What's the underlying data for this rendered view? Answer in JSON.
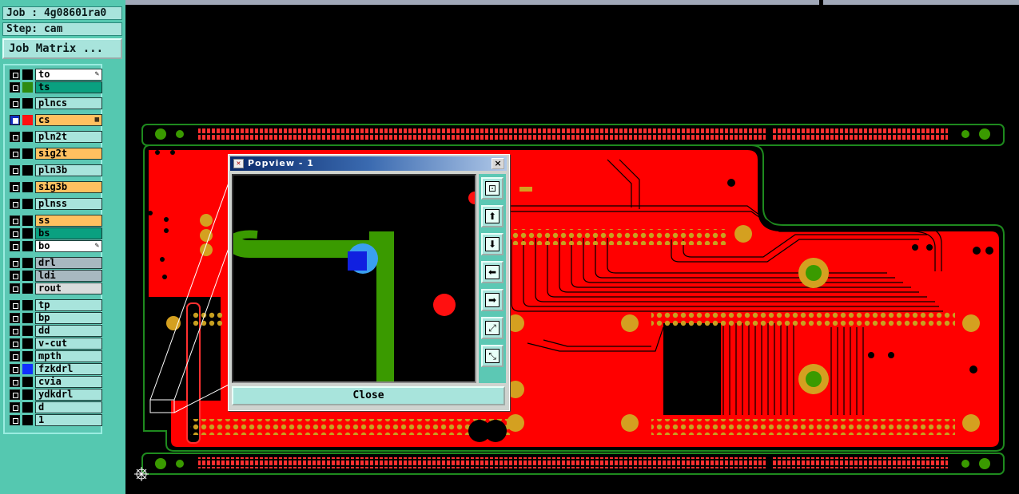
{
  "header": {
    "job_label": "Job : 4g08601ra0",
    "step_label": "Step: cam",
    "job_matrix_button": "Job Matrix ..."
  },
  "layers": [
    {
      "name": "to",
      "checked": false,
      "swatch": "#000000",
      "bg": "#ffffff",
      "marker": "edit"
    },
    {
      "name": "ts",
      "checked": false,
      "swatch": "#2e8b10",
      "bg": "#0aa080",
      "marker": ""
    },
    {
      "name": "plncs",
      "checked": false,
      "swatch": "#000000",
      "bg": "#a8e4dc",
      "marker": ""
    },
    {
      "name": "cs",
      "checked": true,
      "swatch": "#ff1010",
      "bg": "#ffc060",
      "marker": "grid"
    },
    {
      "name": "pln2t",
      "checked": false,
      "swatch": "#000000",
      "bg": "#a8e4dc",
      "marker": ""
    },
    {
      "name": "sig2t",
      "checked": false,
      "swatch": "#000000",
      "bg": "#ffc060",
      "marker": ""
    },
    {
      "name": "pln3b",
      "checked": false,
      "swatch": "#000000",
      "bg": "#a8e4dc",
      "marker": ""
    },
    {
      "name": "sig3b",
      "checked": false,
      "swatch": "#000000",
      "bg": "#ffc060",
      "marker": ""
    },
    {
      "name": "plnss",
      "checked": false,
      "swatch": "#000000",
      "bg": "#a8e4dc",
      "marker": ""
    },
    {
      "name": "ss",
      "checked": false,
      "swatch": "#000000",
      "bg": "#ffc060",
      "marker": ""
    },
    {
      "name": "bs",
      "checked": false,
      "swatch": "#000000",
      "bg": "#0aa080",
      "marker": ""
    },
    {
      "name": "bo",
      "checked": false,
      "swatch": "#000000",
      "bg": "#ffffff",
      "marker": "edit"
    },
    {
      "name": "drl",
      "checked": false,
      "swatch": "#000000",
      "bg": "#a8b8c0",
      "marker": ""
    },
    {
      "name": "ldi",
      "checked": false,
      "swatch": "#000000",
      "bg": "#a8b8c0",
      "marker": ""
    },
    {
      "name": "rout",
      "checked": false,
      "swatch": "#000000",
      "bg": "#d8dcdc",
      "marker": ""
    },
    {
      "name": "tp",
      "checked": false,
      "swatch": "#000000",
      "bg": "#a8e4dc",
      "marker": ""
    },
    {
      "name": "bp",
      "checked": false,
      "swatch": "#000000",
      "bg": "#a8e4dc",
      "marker": ""
    },
    {
      "name": "dd",
      "checked": false,
      "swatch": "#000000",
      "bg": "#a8e4dc",
      "marker": ""
    },
    {
      "name": "v-cut",
      "checked": false,
      "swatch": "#000000",
      "bg": "#a8e4dc",
      "marker": ""
    },
    {
      "name": "mpth",
      "checked": false,
      "swatch": "#000000",
      "bg": "#a8e4dc",
      "marker": ""
    },
    {
      "name": "fzkdrl",
      "checked": false,
      "swatch": "#1030ff",
      "bg": "#a8e4dc",
      "marker": ""
    },
    {
      "name": "cvia",
      "checked": false,
      "swatch": "#000000",
      "bg": "#a8e4dc",
      "marker": ""
    },
    {
      "name": "ydkdrl",
      "checked": false,
      "swatch": "#000000",
      "bg": "#a8e4dc",
      "marker": ""
    },
    {
      "name": "d",
      "checked": false,
      "swatch": "#000000",
      "bg": "#a8e4dc",
      "marker": ""
    },
    {
      "name": "1",
      "checked": false,
      "swatch": "#000000",
      "bg": "#a8e4dc",
      "marker": ""
    }
  ],
  "popview": {
    "title": "Popview - 1",
    "close_x": "×",
    "close_button": "Close",
    "tools": [
      {
        "name": "zoom-window-icon"
      },
      {
        "name": "pan-up-icon"
      },
      {
        "name": "pan-down-icon"
      },
      {
        "name": "pan-left-icon"
      },
      {
        "name": "pan-right-icon"
      },
      {
        "name": "zoom-in-icon"
      },
      {
        "name": "zoom-out-icon"
      }
    ]
  },
  "colors": {
    "board_copper": "#ff0000",
    "board_outline": "#1e8a1e",
    "pad": "#d4a020",
    "trace": "#3a9a00",
    "highlight": "#1030ff",
    "panel_bg": "#55c8b0"
  }
}
